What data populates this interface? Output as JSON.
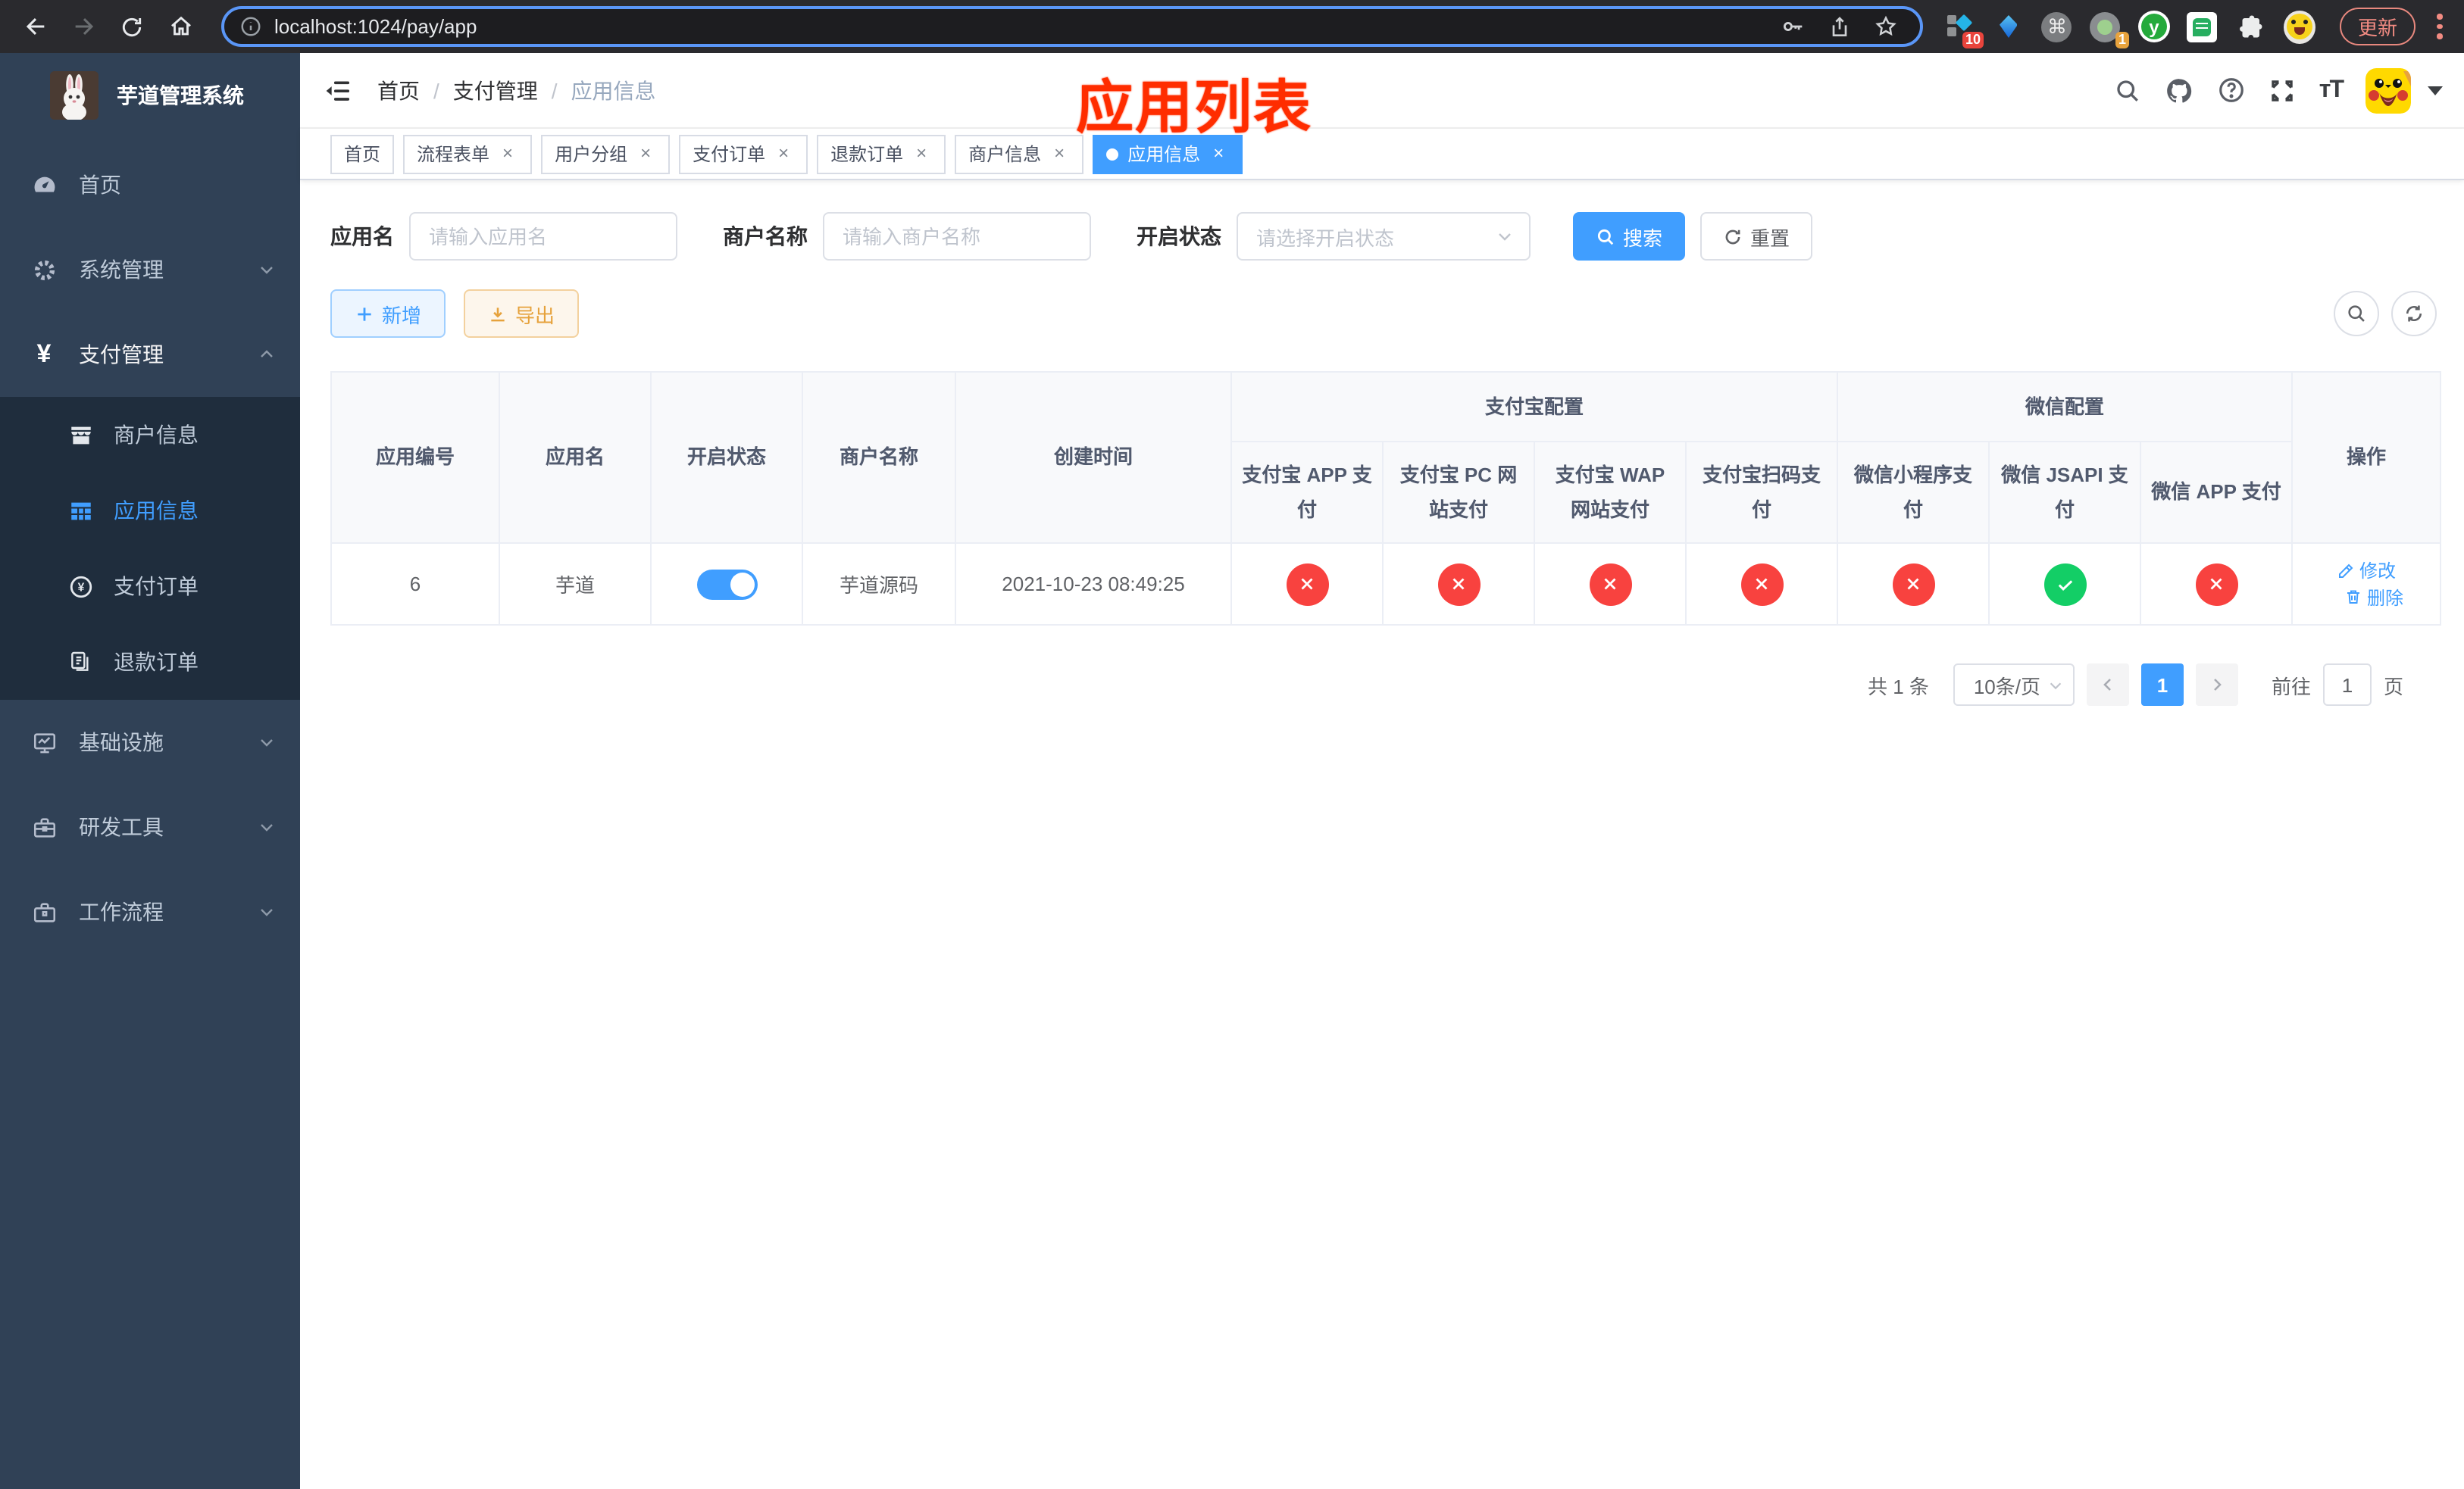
{
  "browser": {
    "url": "localhost:1024/pay/app",
    "update_label": "更新",
    "ext_badge_10": "10",
    "ext_badge_1": "1",
    "ext_y_letter": "y",
    "ext_cmd_glyph": "⌘"
  },
  "sidebar": {
    "title": "芋道管理系统",
    "items": [
      {
        "label": "首页"
      },
      {
        "label": "系统管理"
      },
      {
        "label": "支付管理"
      },
      {
        "label": "商户信息"
      },
      {
        "label": "应用信息"
      },
      {
        "label": "支付订单"
      },
      {
        "label": "退款订单"
      },
      {
        "label": "基础设施"
      },
      {
        "label": "研发工具"
      },
      {
        "label": "工作流程"
      }
    ]
  },
  "header": {
    "breadcrumb": [
      "首页",
      "支付管理",
      "应用信息"
    ],
    "annotation": "应用列表",
    "fontsize_icon_text": "тT"
  },
  "tabs": [
    {
      "label": "首页"
    },
    {
      "label": "流程表单"
    },
    {
      "label": "用户分组"
    },
    {
      "label": "支付订单"
    },
    {
      "label": "退款订单"
    },
    {
      "label": "商户信息"
    },
    {
      "label": "应用信息"
    }
  ],
  "icons": {
    "close": "×"
  },
  "filters": {
    "name_label": "应用名",
    "name_placeholder": "请输入应用名",
    "merchant_label": "商户名称",
    "merchant_placeholder": "请输入商户名称",
    "status_label": "开启状态",
    "status_placeholder": "请选择开启状态",
    "search_label": "搜索",
    "reset_label": "重置"
  },
  "toolbar": {
    "add_label": "新增",
    "export_label": "导出"
  },
  "table": {
    "group_alipay": "支付宝配置",
    "group_wechat": "微信配置",
    "col_id": "应用编号",
    "col_name": "应用名",
    "col_status": "开启状态",
    "col_merchant": "商户名称",
    "col_created": "创建时间",
    "col_alipay_app": "支付宝 APP 支付",
    "col_alipay_pc": "支付宝 PC 网站支付",
    "col_alipay_wap": "支付宝 WAP 网站支付",
    "col_alipay_qr": "支付宝扫码支付",
    "col_wx_lite": "微信小程序支付",
    "col_wx_jsapi": "微信 JSAPI 支付",
    "col_wx_app": "微信 APP 支付",
    "col_actions": "操作",
    "row": {
      "id": "6",
      "name": "芋道",
      "enabled": true,
      "merchant": "芋道源码",
      "created": "2021-10-23 08:49:25",
      "statuses": [
        false,
        false,
        false,
        false,
        false,
        true,
        false
      ],
      "edit_label": "修改",
      "delete_label": "删除"
    }
  },
  "pagination": {
    "total": "共 1 条",
    "page_size": "10条/页",
    "page": "1",
    "goto_label": "前往",
    "goto_value": "1",
    "unit_label": "页"
  },
  "colors": {
    "accent_blue": "#409EFF",
    "status_red": "#f8423f",
    "status_green": "#13ce66",
    "annotation_red": "#ff2d00"
  }
}
